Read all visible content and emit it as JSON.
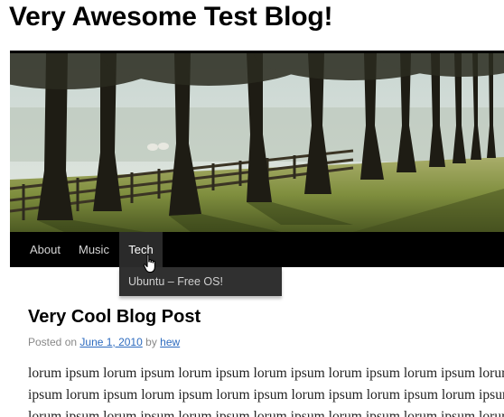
{
  "site": {
    "title": "Very Awesome Test Blog!"
  },
  "header_image": {
    "alt_subject": "tree-lined path with fence"
  },
  "nav": {
    "items": [
      {
        "label": "About"
      },
      {
        "label": "Music"
      },
      {
        "label": "Tech",
        "active": true
      }
    ],
    "dropdown": {
      "items": [
        {
          "label": "Ubuntu – Free OS!"
        }
      ]
    }
  },
  "post": {
    "title": "Very Cool Blog Post",
    "meta": {
      "prefix": "Posted on",
      "date": "June 1, 2010",
      "by": "by",
      "author": "hew"
    },
    "body_lines": [
      "lorum ipsum lorum ipsum lorum ipsum lorum ipsum lorum ipsum lorum ipsum lorum",
      "ipsum lorum ipsum lorum ipsum lorum ipsum lorum ipsum lorum ipsum lorum ipsum",
      "lorum ipsum lorum ipsum lorum ipsum lorum ipsum lorum ipsum lorum ipsum lorum"
    ]
  },
  "colors": {
    "nav_bg": "#000000",
    "nav_active_bg": "#2a2a2a",
    "dropdown_bg": "#303030",
    "link": "#2d6bbf"
  }
}
